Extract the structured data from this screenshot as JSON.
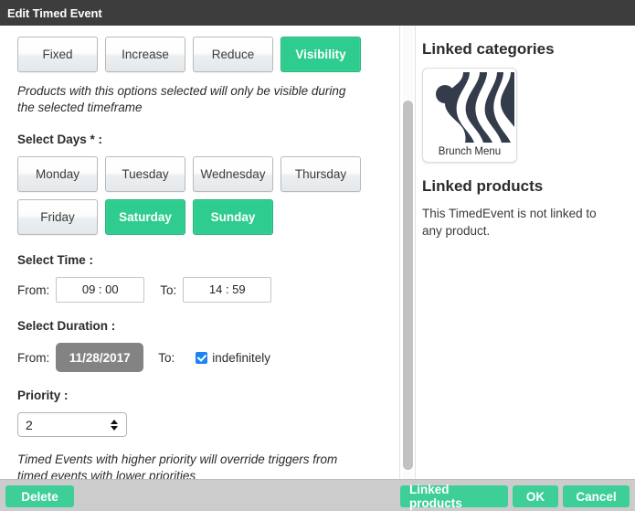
{
  "window": {
    "title": "Edit Timed Event"
  },
  "event_type": {
    "options": [
      "Fixed",
      "Increase",
      "Reduce",
      "Visibility"
    ],
    "selected": "Visibility",
    "hint": "Products with this options selected will only be visible during the selected timeframe"
  },
  "days": {
    "label": "Select Days * :",
    "row1": [
      "Monday",
      "Tuesday",
      "Wednesday",
      "Thursday"
    ],
    "row2": [
      "Friday",
      "Saturday",
      "Sunday"
    ],
    "selected": [
      "Saturday",
      "Sunday"
    ]
  },
  "time": {
    "label": "Select Time :",
    "from_label": "From:",
    "from_value": "09 : 00",
    "to_label": "To:",
    "to_value": "14 : 59"
  },
  "duration": {
    "label": "Select Duration :",
    "from_label": "From:",
    "from_value": "11/28/2017",
    "to_label": "To:",
    "indefinitely_label": "indefinitely",
    "indefinitely_checked": true
  },
  "priority": {
    "label": "Priority :",
    "value": "2",
    "note": "Timed Events with higher priority will override triggers from timed events with lower priorities"
  },
  "linked_categories": {
    "heading": "Linked categories",
    "items": [
      {
        "name": "Brunch Menu"
      }
    ]
  },
  "linked_products": {
    "heading": "Linked products",
    "empty_message": "This TimedEvent is not linked to any product."
  },
  "footer": {
    "delete_label": "Delete",
    "linked_products_label": "Linked products",
    "ok_label": "OK",
    "cancel_label": "Cancel"
  },
  "colors": {
    "titlebar": "#3d3d3d",
    "accent_green": "#2ecc8f",
    "footer_green": "#3ecf98",
    "footer_bg": "#cccccc",
    "date_button": "#838383",
    "checkbox_blue": "#1a84f0",
    "thumbnail_dark": "#343c4c"
  }
}
